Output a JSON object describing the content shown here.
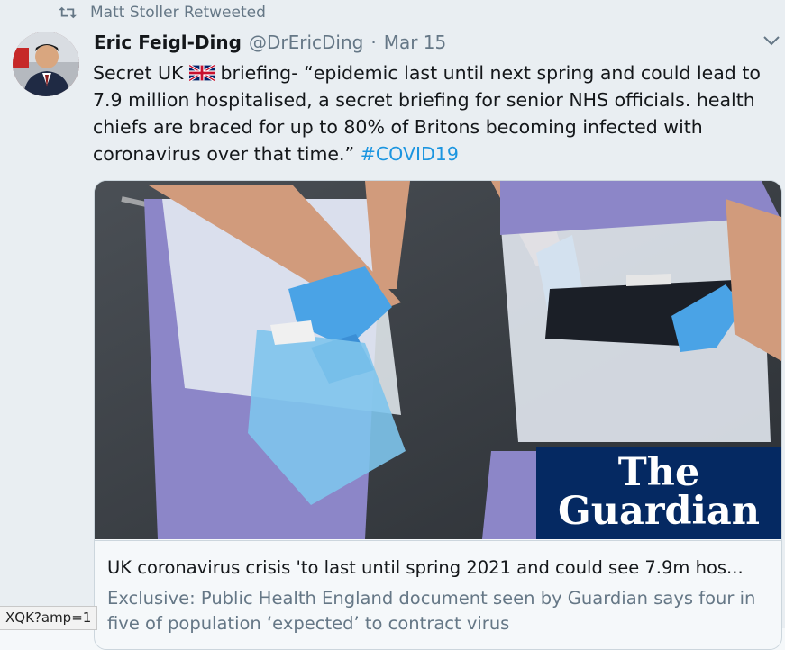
{
  "retweet": {
    "text": "Matt Stoller Retweeted",
    "icon": "retweet-icon"
  },
  "author": {
    "name": "Eric Feigl-Ding",
    "handle": "@DrEricDing",
    "separator": "·",
    "date": "Mar 15"
  },
  "tweet": {
    "text_before_flag": "Secret UK ",
    "text_after_flag": " briefing- “epidemic last until next spring and could lead to 7.9 million hospitalised, a secret briefing for senior NHS officials. health chiefs are braced for up to 80% of Britons becoming infected with coronavirus over that time.” ",
    "hashtag": "#COVID19"
  },
  "card": {
    "brand_line1": "The",
    "brand_line2": "Guardian",
    "title": "UK coronavirus crisis 'to last until spring 2021 and could see 7.9m hos...",
    "description": "Exclusive: Public Health England document seen by Guardian says four in five of population ‘expected’ to contract virus"
  },
  "status_bar": {
    "url": "XQK?amp=1"
  },
  "colors": {
    "link": "#1b95e0",
    "muted": "#657786",
    "guardian_blue": "#052962"
  }
}
